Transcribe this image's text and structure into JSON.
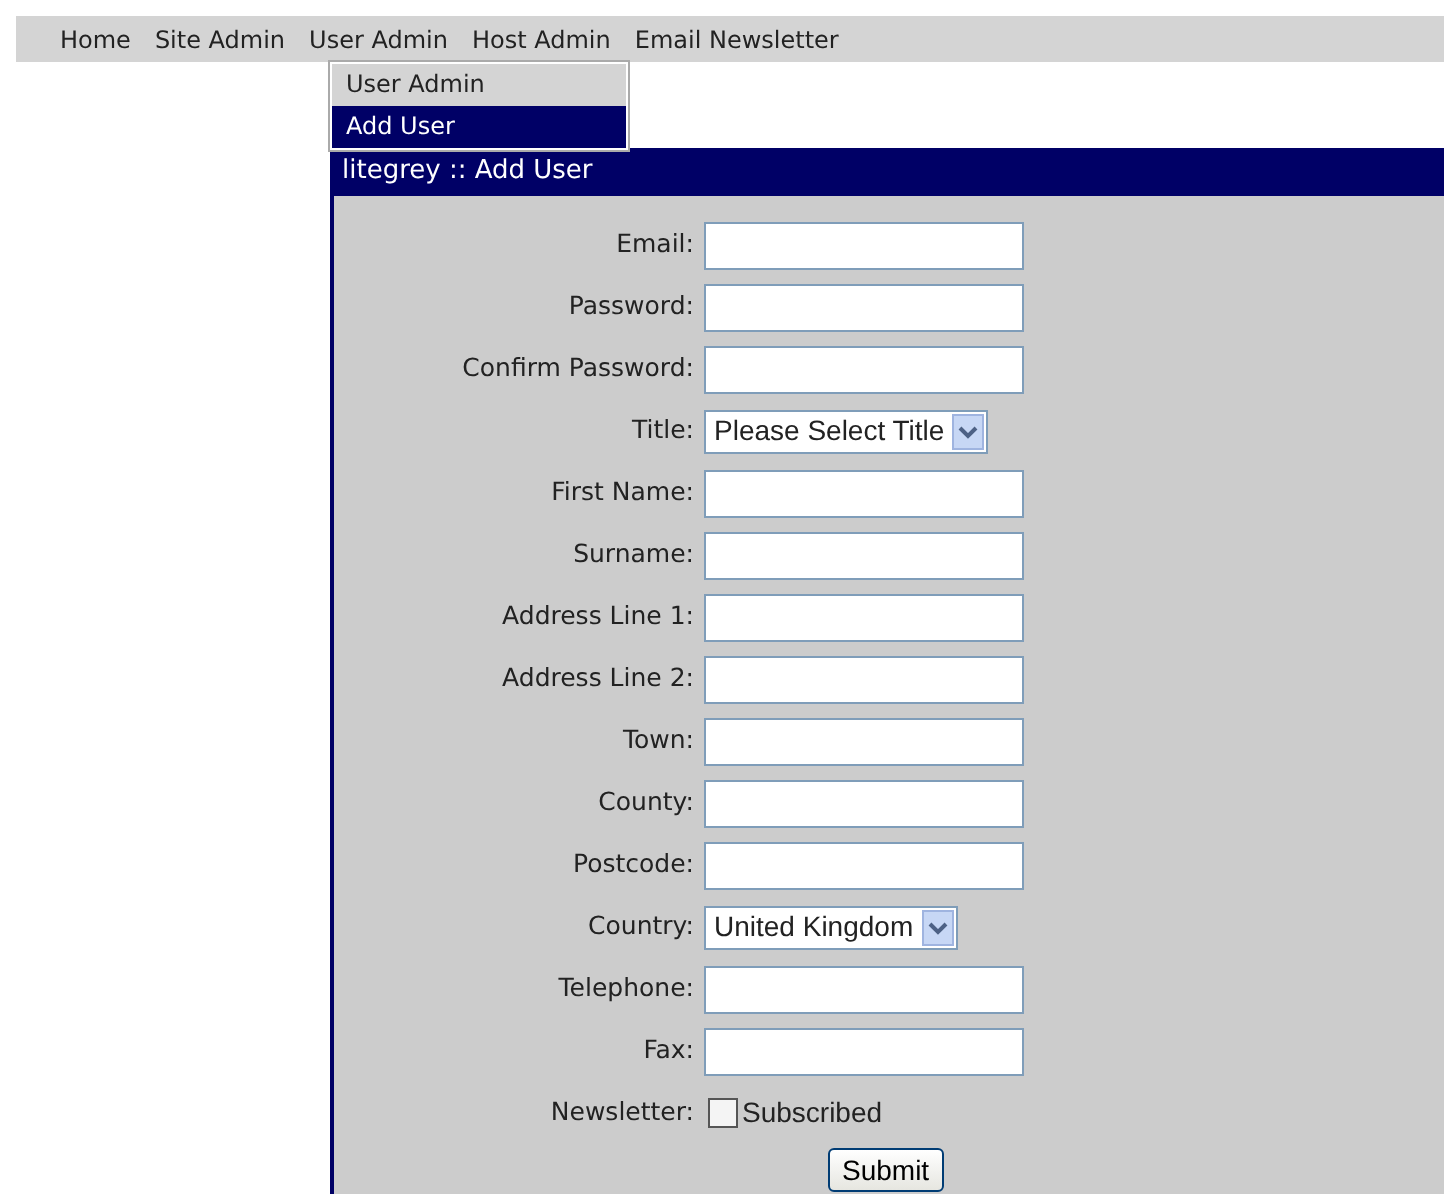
{
  "menu": [
    {
      "label": "Home"
    },
    {
      "label": "Site Admin"
    },
    {
      "label": "User Admin"
    },
    {
      "label": "Host Admin"
    },
    {
      "label": "Email Newsletter"
    }
  ],
  "dropdown": [
    {
      "label": "User Admin",
      "selected": false
    },
    {
      "label": "Add User",
      "selected": true
    }
  ],
  "panel": {
    "title": "litegrey :: Add User"
  },
  "fields": [
    {
      "kind": "text",
      "label": "Email:"
    },
    {
      "kind": "text",
      "label": "Password:"
    },
    {
      "kind": "text",
      "label": "Confirm Password:"
    },
    {
      "kind": "select",
      "label": "Title:",
      "value": "Please Select Title"
    },
    {
      "kind": "text",
      "label": "First Name:"
    },
    {
      "kind": "text",
      "label": "Surname:"
    },
    {
      "kind": "text",
      "label": "Address Line 1:"
    },
    {
      "kind": "text",
      "label": "Address Line 2:"
    },
    {
      "kind": "text",
      "label": "Town:"
    },
    {
      "kind": "text",
      "label": "County:"
    },
    {
      "kind": "text",
      "label": "Postcode:"
    },
    {
      "kind": "select",
      "label": "Country:",
      "value": "United Kingdom"
    },
    {
      "kind": "text",
      "label": "Telephone:"
    },
    {
      "kind": "text",
      "label": "Fax:"
    },
    {
      "kind": "checkbox",
      "label": "Newsletter:",
      "text": "Subscribed",
      "checked": false
    }
  ],
  "submit": "Submit"
}
